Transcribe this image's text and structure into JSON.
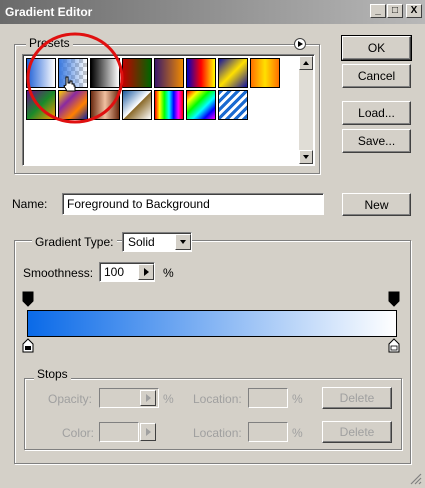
{
  "window": {
    "title": "Gradient Editor",
    "controls": [
      "_",
      "□",
      "X"
    ]
  },
  "presets": {
    "label": "Presets",
    "menu_icon": "right-arrow-circle-icon",
    "swatches": [
      {
        "name": "foreground-to-background",
        "css": "linear-gradient(to right,#1e5fd6,#ffffff)"
      },
      {
        "name": "foreground-to-transparent",
        "css": "linear-gradient(to right,#3b7ae0,rgba(255,255,255,0)),repeating-conic-gradient(#c8c8c8 0 25%,#ffffff 0 50%) 0 0/8px 8px"
      },
      {
        "name": "black-white",
        "css": "linear-gradient(to right,#000000,#ffffff)"
      },
      {
        "name": "red-green",
        "css": "linear-gradient(to right,#c00000,#006600)"
      },
      {
        "name": "violet-orange",
        "css": "linear-gradient(to right,#3a1a6a,#f08a00)"
      },
      {
        "name": "blue-red-yellow",
        "css": "linear-gradient(to right,#0000c0,#ff0000,#ffff00)"
      },
      {
        "name": "blue-yellow-blue",
        "css": "linear-gradient(135deg,#1010a0,#ffe000,#1010a0)"
      },
      {
        "name": "orange-yellow-orange",
        "css": "linear-gradient(to right,#ff7000,#ffe000,#ff7000)"
      },
      {
        "name": "violet-green-orange",
        "css": "linear-gradient(135deg,#6a0a8a,#1a8a2a,#ff9a00)"
      },
      {
        "name": "yellow-violet-orange-blue",
        "css": "linear-gradient(135deg,#ffd000,#8a2aa0,#ff8000,#1020a0)"
      },
      {
        "name": "copper",
        "css": "linear-gradient(to right,#6a2a10,#f0c0a0,#6a2a10)"
      },
      {
        "name": "chrome",
        "css": "linear-gradient(135deg,#1a5aa0,#ffffff 50%,#8a6a2a 52%,#ffffff)"
      },
      {
        "name": "spectrum",
        "css": "linear-gradient(to right,#ff0000,#ffff00,#00ff00,#00ffff,#0000ff,#ff00ff,#ff0000)"
      },
      {
        "name": "transparent-rainbow",
        "css": "linear-gradient(135deg,#ff0000,#ffff00,#00ff00,#00ffff,#0000ff,#ff00ff)"
      },
      {
        "name": "transparent-stripes",
        "css": "repeating-linear-gradient(135deg,#1a6ad0 0 3px,#ffffff 3px 6px)"
      }
    ]
  },
  "buttons": {
    "ok": "OK",
    "cancel": "Cancel",
    "load": "Load...",
    "save": "Save...",
    "new": "New"
  },
  "name": {
    "label": "Name:",
    "value": "Foreground to Background"
  },
  "gradient_type": {
    "label": "Gradient Type:",
    "value": "Solid"
  },
  "smoothness": {
    "label": "Smoothness:",
    "value": "100",
    "unit": "%"
  },
  "gradient_bar": {
    "css": "linear-gradient(to right,#0a6ae8,#ffffff)",
    "color_start": "#0a6ae8",
    "color_end": "#ffffff"
  },
  "stops": {
    "label": "Stops",
    "opacity_label": "Opacity:",
    "opacity_unit": "%",
    "location_label": "Location:",
    "location_unit": "%",
    "color_label": "Color:",
    "delete_label": "Delete"
  }
}
